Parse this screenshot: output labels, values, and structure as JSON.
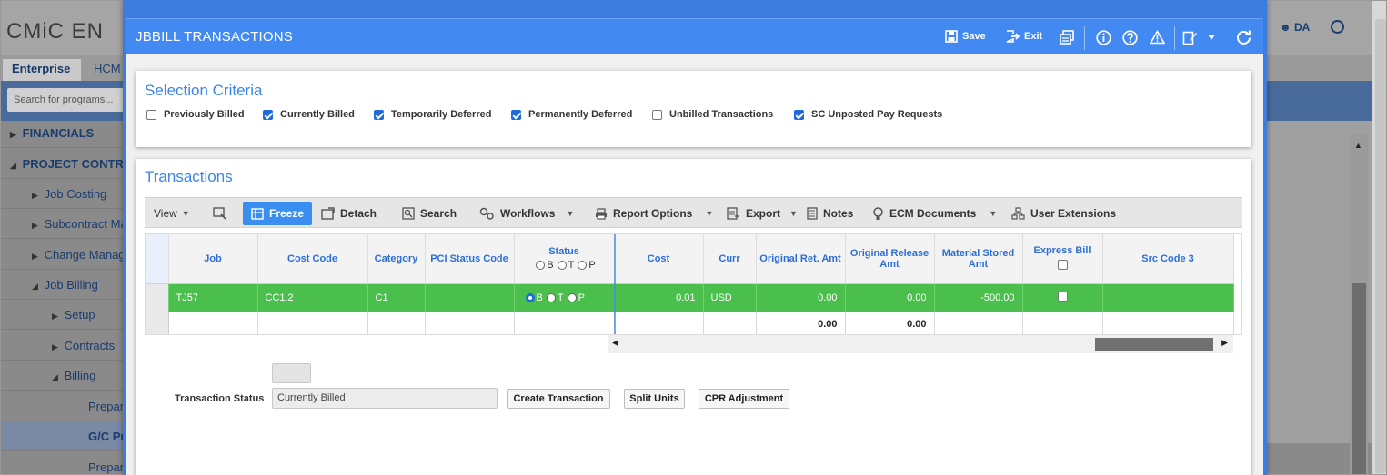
{
  "background": {
    "logo_text": "CMiC EN",
    "tabs": [
      "Enterprise",
      "HCM"
    ],
    "search_placeholder": "Search for programs...",
    "user_initials": "DA",
    "nav": [
      {
        "label": "FINANCIALS",
        "arrow": "▶"
      },
      {
        "label": "PROJECT CONTR",
        "arrow": "◢"
      },
      {
        "label": "Job Costing",
        "arrow": "▶"
      },
      {
        "label": "Subcontract Ma",
        "arrow": "▶"
      },
      {
        "label": "Change Manag",
        "arrow": "▶"
      },
      {
        "label": "Job Billing",
        "arrow": "◢"
      },
      {
        "label": "Setup",
        "arrow": "▶"
      },
      {
        "label": "Contracts",
        "arrow": "▶"
      },
      {
        "label": "Billing",
        "arrow": "◢"
      },
      {
        "label": "Prepar",
        "arrow": ""
      },
      {
        "label": "G/C Pr",
        "arrow": ""
      },
      {
        "label": "Prepar",
        "arrow": ""
      }
    ]
  },
  "modal": {
    "title": "JBBILL TRANSACTIONS",
    "save_label": "Save",
    "exit_label": "Exit",
    "accent_color": "#4289f2"
  },
  "selection": {
    "title": "Selection Criteria",
    "criteria": [
      {
        "label": "Previously Billed",
        "checked": false
      },
      {
        "label": "Currently Billed",
        "checked": true
      },
      {
        "label": "Temporarily Deferred",
        "checked": true
      },
      {
        "label": "Permanently Deferred",
        "checked": true
      },
      {
        "label": "Unbilled Transactions",
        "checked": false
      },
      {
        "label": "SC Unposted Pay Requests",
        "checked": true
      }
    ]
  },
  "transactions": {
    "title": "Transactions",
    "toolbar": {
      "view": "View",
      "freeze": "Freeze",
      "detach": "Detach",
      "search": "Search",
      "workflows": "Workflows",
      "report_options": "Report Options",
      "export": "Export",
      "notes": "Notes",
      "ecm_documents": "ECM Documents",
      "user_extensions": "User Extensions"
    },
    "columns": {
      "job": "Job",
      "cost_code": "Cost Code",
      "category": "Category",
      "pci_status_code": "PCI Status Code",
      "status": "Status",
      "status_b": "B",
      "status_t": "T",
      "status_p": "P",
      "cost": "Cost",
      "curr": "Curr",
      "original_ret_amt": "Original Ret. Amt",
      "original_release_amt": "Original Release Amt",
      "material_stored_amt": "Material Stored Amt",
      "express_bill": "Express Bill",
      "src_code_3": "Src Code 3"
    },
    "row": {
      "job": "TJ57",
      "cost_code": "CC1.2",
      "category": "C1",
      "pci_status_code": "",
      "status": "B",
      "status_b": "B",
      "status_t": "T",
      "status_p": "P",
      "cost": "0.01",
      "curr": "USD",
      "original_ret_amt": "0.00",
      "original_release_amt": "0.00",
      "material_stored_amt": "-500.00",
      "express_bill": false,
      "src_code_3": ""
    },
    "totals": {
      "original_ret_amt": "0.00",
      "original_release_amt": "0.00"
    },
    "row_color": "#4bbf4b"
  },
  "footer": {
    "transaction_status_label": "Transaction Status",
    "transaction_status_value": "Currently Billed",
    "create_transaction": "Create Transaction",
    "split_units": "Split Units",
    "cpr_adjustment": "CPR Adjustment"
  }
}
